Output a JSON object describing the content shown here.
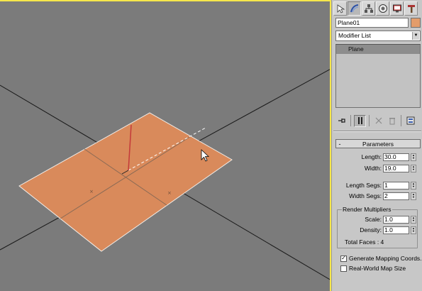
{
  "viewport": {
    "accent_border": "#f5e64b",
    "background": "#7b7b7b",
    "plane_fill": "#d98a5b",
    "pivot_color": "#c43a3a"
  },
  "command_panel": {
    "tabs": [
      {
        "icon": "cursor-create-icon"
      },
      {
        "icon": "modify-bend-icon"
      },
      {
        "icon": "hierarchy-icon"
      },
      {
        "icon": "motion-icon"
      },
      {
        "icon": "display-monitor-icon"
      },
      {
        "icon": "utilities-hammer-icon"
      }
    ],
    "object_name": "Plane01",
    "object_color": "#e39c6a",
    "modifier_list_label": "Modifier List",
    "stack_items": [
      "Plane"
    ],
    "stack_tools": [
      {
        "icon": "pin-stack-icon"
      },
      {
        "icon": "show-end-result-icon"
      },
      {
        "icon": "make-unique-icon"
      },
      {
        "icon": "remove-modifier-icon"
      },
      {
        "icon": "configure-modifier-sets-icon"
      }
    ]
  },
  "parameters": {
    "rollout_sign": "-",
    "title": "Parameters",
    "length_label": "Length:",
    "length_value": "30.0",
    "width_label": "Width:",
    "width_value": "19.0",
    "length_segs_label": "Length Segs:",
    "length_segs_value": "1",
    "width_segs_label": "Width Segs:",
    "width_segs_value": "2",
    "render_multipliers_label": "Render Multipliers",
    "scale_label": "Scale:",
    "scale_value": "1.0",
    "density_label": "Density:",
    "density_value": "1.0",
    "total_faces_text": "Total Faces : 4",
    "generate_mapping_label": "Generate Mapping Coords.",
    "generate_mapping_checked": true,
    "generate_mapping_mark": "✓",
    "real_world_label": "Real-World Map Size",
    "real_world_checked": false
  }
}
